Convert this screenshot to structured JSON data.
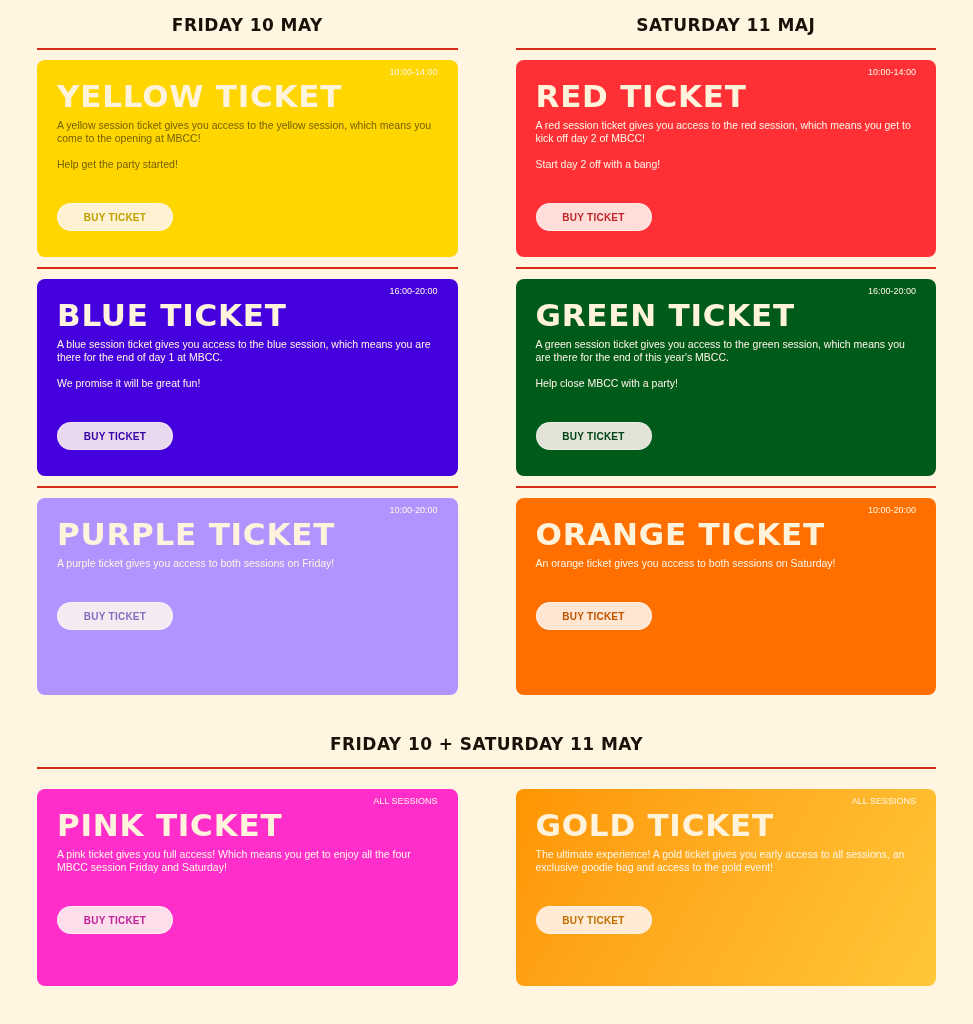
{
  "columns": [
    {
      "heading": "FRIDAY 10 MAY",
      "cards": [
        {
          "kind": "solid",
          "color": "#ffd600",
          "time": "10:00-14:00",
          "title": "YELLOW TICKET",
          "paragraphs": [
            "A yellow session ticket gives you access to the yellow session, which means you come to the opening at MBCC!",
            "Help get the party started!"
          ],
          "button": "BUY TICKET"
        },
        {
          "kind": "solid",
          "color": "#4400dd",
          "time": "16:00-20:00",
          "title": "BLUE TICKET",
          "paragraphs": [
            "A blue session ticket gives you access to the blue session, which means you are there for the end of day 1 at MBCC.",
            "We promise it will be great fun!"
          ],
          "button": "BUY TICKET"
        },
        {
          "kind": "solid",
          "color": "#b194ff",
          "time": "10:00-20:00",
          "title": "PURPLE TICKET",
          "paragraphs": [
            "A purple ticket gives you access to both sessions on Friday!"
          ],
          "button": "BUY TICKET"
        }
      ]
    },
    {
      "heading": "SATURDAY 11 MAJ",
      "cards": [
        {
          "kind": "solid",
          "color": "#ff3035",
          "time": "10:00-14:00",
          "title": "RED TICKET",
          "paragraphs": [
            "A red session ticket gives you access to the red session, which means you get to kick off day 2 of MBCC!",
            "Start day 2 off with a bang!"
          ],
          "button": "BUY TICKET"
        },
        {
          "kind": "solid",
          "color": "#005a1a",
          "time": "16:00-20:00",
          "title": "GREEN TICKET",
          "paragraphs": [
            "A green session ticket gives you access to the green session, which means you are there for the end of this year's MBCC.",
            "Help close MBCC with a party!"
          ],
          "button": "BUY TICKET"
        },
        {
          "kind": "solid",
          "color": "#ff6f00",
          "time": "10:00-20:00",
          "title": "ORANGE TICKET",
          "paragraphs": [
            "An orange ticket gives you access to both sessions on Saturday!"
          ],
          "button": "BUY TICKET"
        }
      ]
    }
  ],
  "combined": {
    "heading": "FRIDAY 10 + SATURDAY 11 MAY",
    "cards": [
      {
        "kind": "solid",
        "color": "#ff2ecb",
        "time": "ALL SESSIONS",
        "title": "PINK TICKET",
        "paragraphs": [
          "A pink ticket gives you full access! Which means you get to enjoy all the four MBCC session Friday and Saturday!"
        ],
        "button": "BUY TICKET"
      },
      {
        "kind": "gradient",
        "color": "#ff9500",
        "time": "ALL SESSIONS",
        "title": "GOLD TICKET",
        "paragraphs": [
          "The ultimate experience! A gold ticket gives you early access to all sessions, an exclusive goodie bag and access to the gold event!"
        ],
        "button": "BUY TICKET"
      }
    ]
  }
}
